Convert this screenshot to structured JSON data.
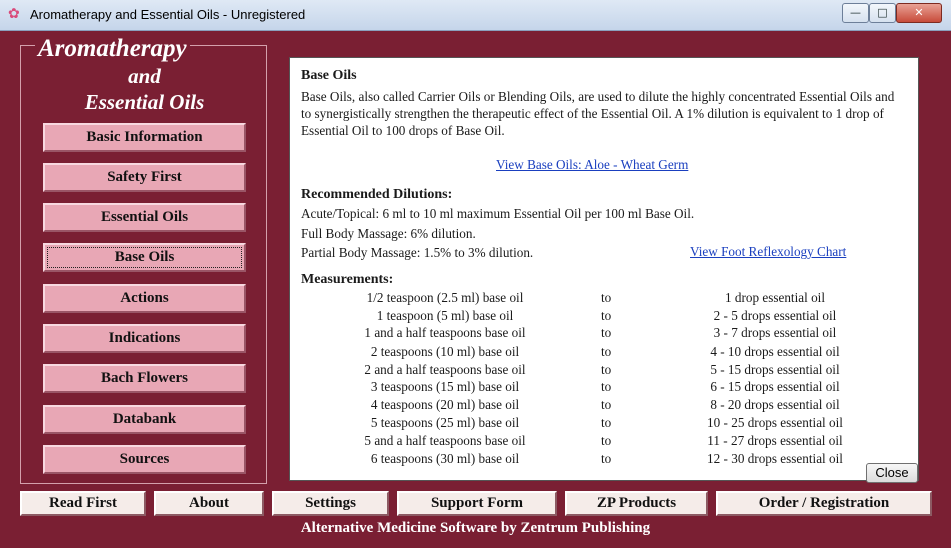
{
  "window": {
    "title": "Aromatherapy and Essential Oils - Unregistered",
    "minimize": "—",
    "maximize": "□",
    "close": "✕"
  },
  "logo": {
    "line1": "Aromatherapy",
    "line2": "and",
    "line3": "Essential Oils"
  },
  "nav": [
    {
      "label": "Basic Information"
    },
    {
      "label": "Safety First"
    },
    {
      "label": "Essential Oils"
    },
    {
      "label": "Base Oils",
      "active": true
    },
    {
      "label": "Actions"
    },
    {
      "label": "Indications"
    },
    {
      "label": "Bach Flowers"
    },
    {
      "label": "Databank"
    },
    {
      "label": "Sources"
    }
  ],
  "content": {
    "title": "Base Oils",
    "intro": "Base Oils, also called Carrier Oils or Blending Oils, are used to dilute the highly concentrated Essential Oils and to synergistically strengthen the therapeutic effect of the Essential Oil. A 1% dilution is equivalent to 1 drop of Essential Oil to 100 drops of Base Oil.",
    "view_base_oils_link": "View Base Oils:  Aloe - Wheat Germ",
    "dilutions_heading": "Recommended Dilutions:",
    "dilution1": "Acute/Topical: 6 ml to 10 ml maximum Essential Oil per 100 ml Base Oil.",
    "dilution2": "Full Body Massage: 6% dilution.",
    "dilution3": "Partial Body Massage: 1.5% to 3% dilution.",
    "foot_chart_link": "View Foot Reflexology Chart",
    "measurements_heading": "Measurements:",
    "measurements": [
      {
        "base": "1/2 teaspoon (2.5 ml) base oil",
        "to": "to",
        "oil": "1 drop essential oil"
      },
      {
        "base": "1 teaspoon (5 ml) base oil",
        "to": "to",
        "oil": "2 - 5 drops essential oil"
      },
      {
        "base": "1 and a half teaspoons base oil",
        "to": "to",
        "oil": "3 - 7 drops essential oil"
      },
      {
        "base": "2 teaspoons (10 ml) base oil",
        "to": "to",
        "oil": "4 - 10 drops essential oil"
      },
      {
        "base": "2 and a half teaspoons base oil",
        "to": "to",
        "oil": "5 - 15 drops essential oil"
      },
      {
        "base": "3 teaspoons (15 ml) base oil",
        "to": "to",
        "oil": "6 - 15 drops essential oil"
      },
      {
        "base": "4 teaspoons (20 ml) base oil",
        "to": "to",
        "oil": "8 - 20 drops essential oil"
      },
      {
        "base": "5 teaspoons (25 ml) base oil",
        "to": "to",
        "oil": "10 - 25 drops essential oil"
      },
      {
        "base": "5 and a half teaspoons base oil",
        "to": "to",
        "oil": "11 - 27 drops essential oil"
      },
      {
        "base": "6 teaspoons (30 ml) base oil",
        "to": "to",
        "oil": "12 - 30 drops essential oil"
      }
    ],
    "close_label": "Close"
  },
  "bottom": [
    "Read First",
    "About",
    "Settings",
    "Support Form",
    "ZP Products",
    "Order / Registration"
  ],
  "footer": "Alternative Medicine Software by Zentrum Publishing",
  "icons": {
    "app": "flower-icon"
  }
}
